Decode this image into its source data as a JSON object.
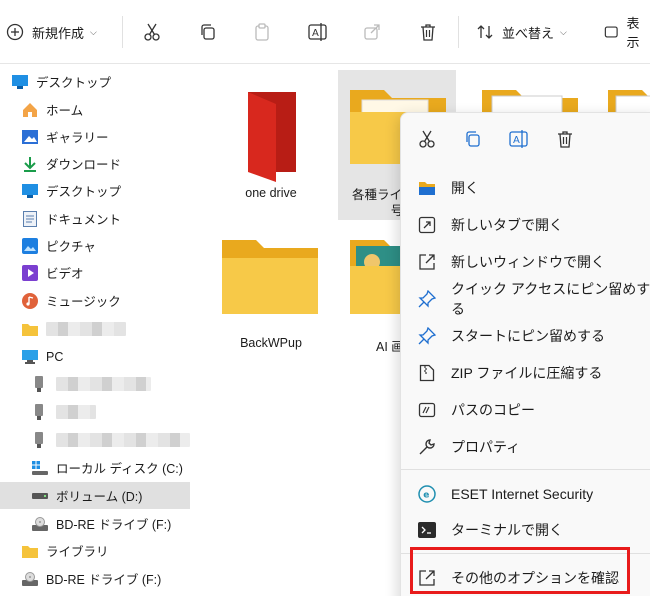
{
  "toolbar": {
    "new_label": "新規作成",
    "sort_label": "並べ替え",
    "view_label": "表示"
  },
  "sidebar": {
    "items": [
      {
        "label": "デスクトップ"
      },
      {
        "label": "ホーム"
      },
      {
        "label": "ギャラリー"
      },
      {
        "label": "ダウンロード"
      },
      {
        "label": "デスクトップ"
      },
      {
        "label": "ドキュメント"
      },
      {
        "label": "ピクチャ"
      },
      {
        "label": "ビデオ"
      },
      {
        "label": "ミュージック"
      },
      {
        "label": "PC"
      },
      {
        "label": "ローカル ディスク (C:)"
      },
      {
        "label": "ボリューム (D:)"
      },
      {
        "label": "BD-RE ドライブ (F:)"
      },
      {
        "label": "ライブラリ"
      },
      {
        "label": "BD-RE ドライブ (F:)"
      }
    ]
  },
  "files": [
    {
      "label": "one drive"
    },
    {
      "label": "各種ライ"
    },
    {
      "label": "号"
    },
    {
      "label": "BackWPup"
    },
    {
      "label": "AI 画"
    }
  ],
  "context_menu": {
    "items": [
      {
        "label": "開く"
      },
      {
        "label": "新しいタブで開く"
      },
      {
        "label": "新しいウィンドウで開く"
      },
      {
        "label": "クイック アクセスにピン留めする"
      },
      {
        "label": "スタートにピン留めする"
      },
      {
        "label": "ZIP ファイルに圧縮する"
      },
      {
        "label": "パスのコピー"
      },
      {
        "label": "プロパティ"
      },
      {
        "label": "ESET Internet Security"
      },
      {
        "label": "ターミナルで開く"
      },
      {
        "label": "その他のオプションを確認"
      }
    ]
  },
  "colors": {
    "folder_yellow": "#f7c948",
    "onedrive_red": "#d8281e",
    "highlight_red": "#e81b1b",
    "selection_gray": "#e0e0e0"
  }
}
